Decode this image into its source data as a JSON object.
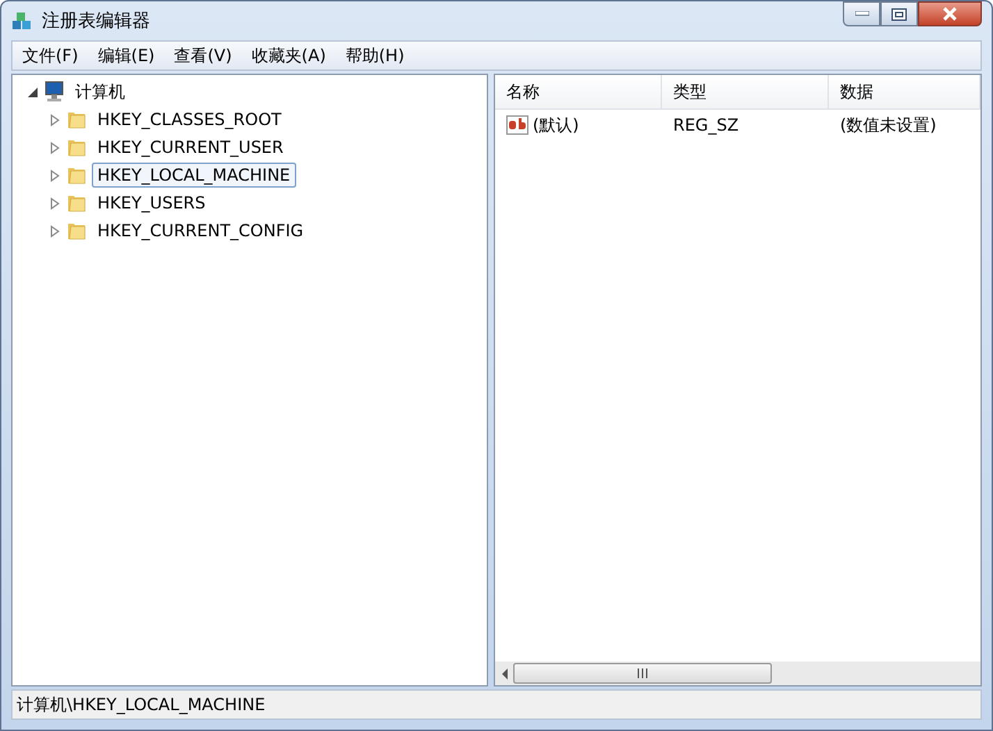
{
  "window": {
    "title": "注册表编辑器"
  },
  "menu": [
    "文件(F)",
    "编辑(E)",
    "查看(V)",
    "收藏夹(A)",
    "帮助(H)"
  ],
  "tree": {
    "label": "计算机",
    "expanded": true,
    "children": [
      {
        "label": "HKEY_CLASSES_ROOT",
        "expanded": false,
        "selected": false
      },
      {
        "label": "HKEY_CURRENT_USER",
        "expanded": false,
        "selected": false
      },
      {
        "label": "HKEY_LOCAL_MACHINE",
        "expanded": false,
        "selected": true
      },
      {
        "label": "HKEY_USERS",
        "expanded": false,
        "selected": false
      },
      {
        "label": "HKEY_CURRENT_CONFIG",
        "expanded": false,
        "selected": false
      }
    ]
  },
  "table": {
    "columns": [
      "名称",
      "类型",
      "数据"
    ],
    "rows": [
      {
        "name": "(默认)",
        "type": "REG_SZ",
        "data": "(数值未设置)"
      }
    ]
  },
  "status_bar": "计算机\\HKEY_LOCAL_MACHINE"
}
